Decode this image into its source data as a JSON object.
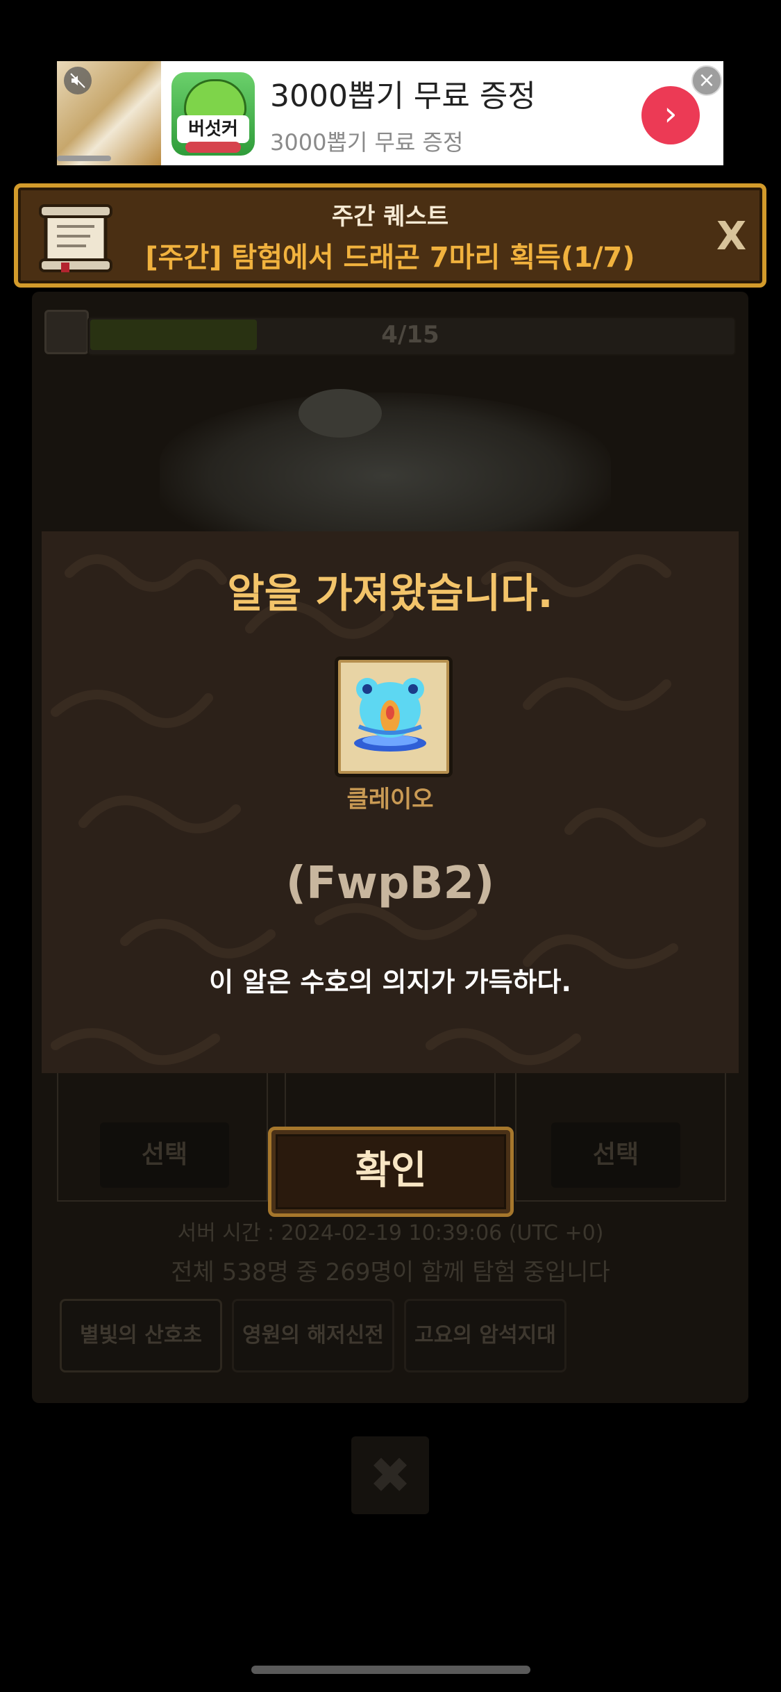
{
  "ad": {
    "title": "3000뽑기 무료 증정",
    "subtitle": "3000뽑기 무료 증정",
    "app_icon_text": "버섯커",
    "mute_icon": "mute-icon",
    "go_icon": "›",
    "close_icon": "×"
  },
  "background": {
    "progress_text": "4/15",
    "progress_fraction": 0.27,
    "select_label": "선택",
    "server_time": "서버 시간 : 2024-02-19 10:39:06 (UTC +0)",
    "participants": "전체 538명 중 269명이 함께 탐험 중입니다",
    "tabs": [
      "별빛의 산호초",
      "영원의 해저신전",
      "고요의 암석지대"
    ],
    "close_icon": "✖"
  },
  "quest": {
    "title": "주간 퀘스트",
    "description": "[주간] 탐험에서 드래곤 7마리 획득(1/7)",
    "close_label": "X"
  },
  "modal": {
    "title": "알을 가져왔습니다.",
    "egg_name": "클레이오",
    "egg_code": "(FwpB2)",
    "description": "이 알은 수호의 의지가 가득하다.",
    "confirm_label": "확인"
  }
}
